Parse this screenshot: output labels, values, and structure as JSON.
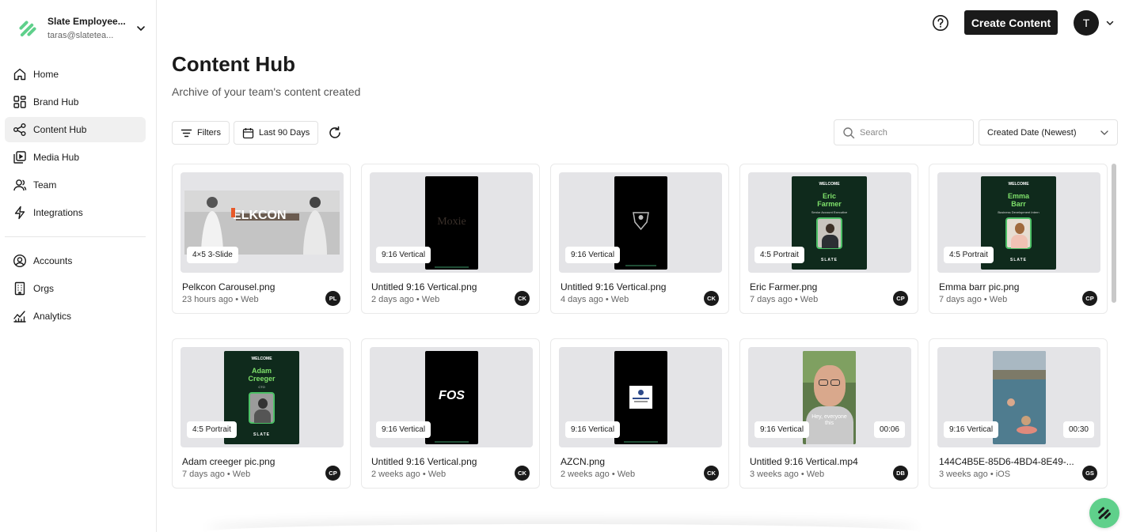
{
  "brand": {
    "accent": "#5fd08b",
    "dark": "#1a1a1a"
  },
  "org": {
    "name": "Slate Employee...",
    "email": "taras@slatetea..."
  },
  "sidebar": {
    "items": [
      {
        "label": "Home",
        "icon": "home-icon",
        "active": false
      },
      {
        "label": "Brand Hub",
        "icon": "grid-icon",
        "active": false
      },
      {
        "label": "Content Hub",
        "icon": "share-nodes-icon",
        "active": true
      },
      {
        "label": "Media Hub",
        "icon": "media-icon",
        "active": false
      },
      {
        "label": "Team",
        "icon": "team-icon",
        "active": false
      },
      {
        "label": "Integrations",
        "icon": "lightning-icon",
        "active": false
      }
    ],
    "admin_items": [
      {
        "label": "Accounts",
        "icon": "user-circle-icon"
      },
      {
        "label": "Orgs",
        "icon": "building-icon"
      },
      {
        "label": "Analytics",
        "icon": "chart-line-icon"
      }
    ]
  },
  "header": {
    "create_label": "Create Content",
    "avatar_initial": "T"
  },
  "page": {
    "title": "Content Hub",
    "subtitle": "Archive of your team's content created"
  },
  "toolbar": {
    "filters_label": "Filters",
    "date_label": "Last 90 Days",
    "search_placeholder": "Search",
    "sort_label": "Created Date (Newest)"
  },
  "cards": [
    {
      "title": "Pelkcon Carousel.png",
      "meta": "23 hours ago • Web",
      "format": "4×5 3-Slide",
      "initials": "PL",
      "thumb": "landscape-photo",
      "thumb_text": "ELKCON"
    },
    {
      "title": "Untitled 9:16 Vertical.png",
      "meta": "2 days ago • Web",
      "format": "9:16 Vertical",
      "initials": "CK",
      "thumb": "black-vertical",
      "thumb_text": "Moxie"
    },
    {
      "title": "Untitled 9:16 Vertical.png",
      "meta": "4 days ago • Web",
      "format": "9:16 Vertical",
      "initials": "CK",
      "thumb": "black-crest",
      "thumb_text": ""
    },
    {
      "title": "Eric Farmer.png",
      "meta": "7 days ago • Web",
      "format": "4:5 Portrait",
      "initials": "CP",
      "thumb": "welcome-card",
      "welcome": "WELCOME",
      "name_line1": "Eric",
      "name_line2": "Farmer",
      "role": "Senior Account Executive",
      "logo_text": "SLATE"
    },
    {
      "title": "Emma barr pic.png",
      "meta": "7 days ago • Web",
      "format": "4:5 Portrait",
      "initials": "CP",
      "thumb": "welcome-card",
      "welcome": "WELCOME",
      "name_line1": "Emma",
      "name_line2": "Barr",
      "role": "Business Development Intern",
      "logo_text": "SLATE"
    },
    {
      "title": "Adam creeger pic.png",
      "meta": "7 days ago • Web",
      "format": "4:5 Portrait",
      "initials": "CP",
      "thumb": "welcome-card",
      "welcome": "WELCOME",
      "name_line1": "Adam",
      "name_line2": "Creeger",
      "role": "CTO",
      "logo_text": "SLATE"
    },
    {
      "title": "Untitled 9:16 Vertical.png",
      "meta": "2 weeks ago • Web",
      "format": "9:16 Vertical",
      "initials": "CK",
      "thumb": "black-vertical-fos",
      "thumb_text": "FOS"
    },
    {
      "title": "AZCN.png",
      "meta": "2 weeks ago • Web",
      "format": "9:16 Vertical",
      "initials": "CK",
      "thumb": "black-badge",
      "thumb_text": ""
    },
    {
      "title": "Untitled 9:16 Vertical.mp4",
      "meta": "3 weeks ago • Web",
      "format": "9:16 Vertical",
      "duration": "00:06",
      "initials": "DB",
      "thumb": "selfie-video",
      "thumb_text": "Hey, everyone this"
    },
    {
      "title": "144C4B5E-85D6-4BD4-8E49-...",
      "meta": "3 weeks ago • iOS",
      "format": "9:16 Vertical",
      "duration": "00:30",
      "initials": "GS",
      "thumb": "pool-video",
      "thumb_text": ""
    }
  ]
}
